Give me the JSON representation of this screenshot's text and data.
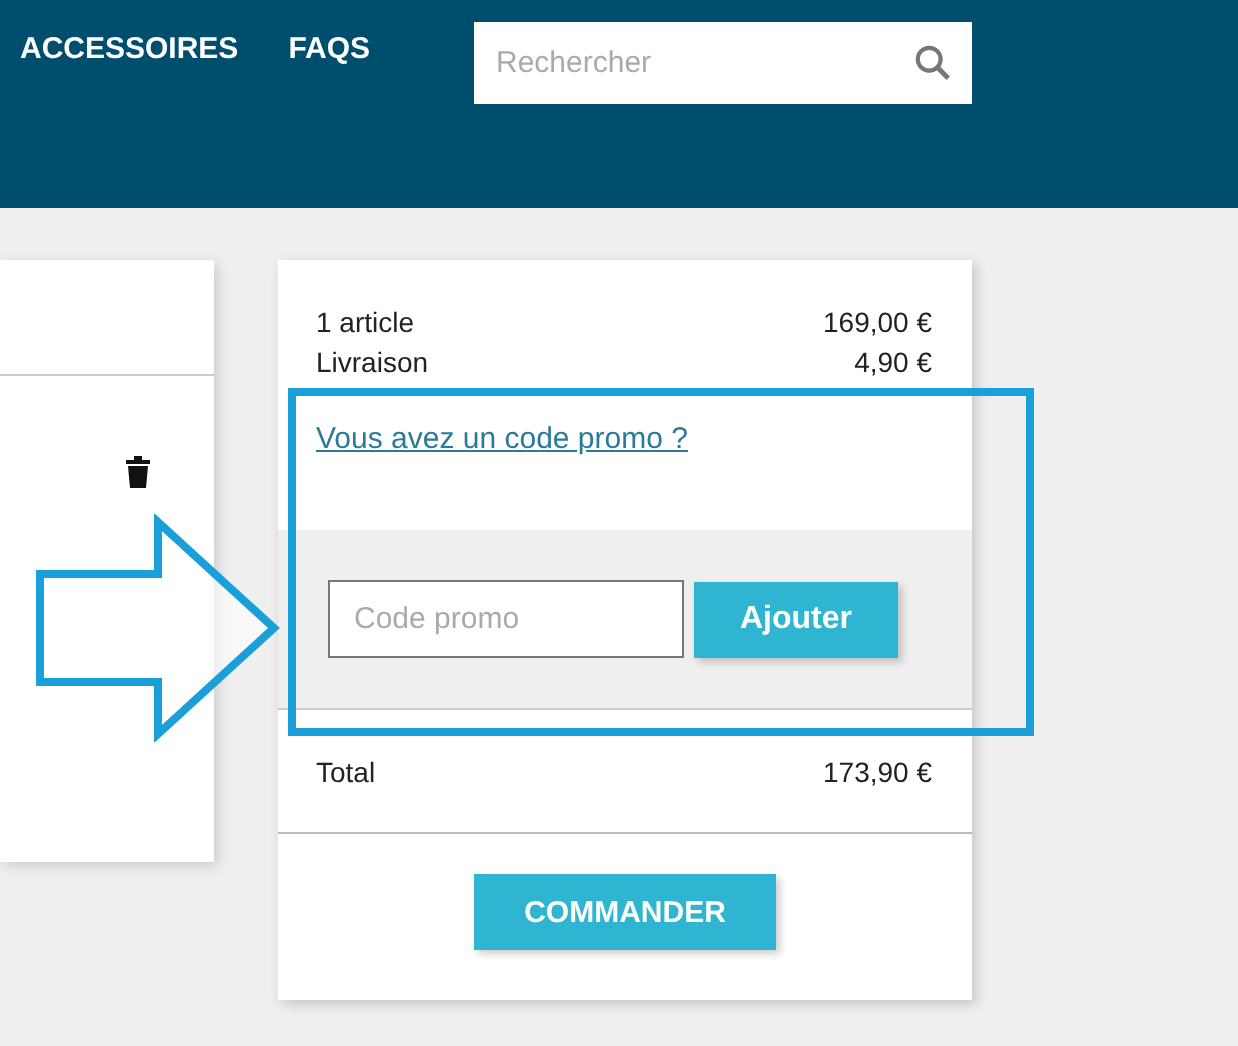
{
  "nav": {
    "items": [
      "ACCESSOIRES",
      "FAQS"
    ]
  },
  "search": {
    "placeholder": "Rechercher"
  },
  "summary": {
    "lines": [
      {
        "label": "1 article",
        "value": "169,00 €"
      },
      {
        "label": "Livraison",
        "value": "4,90 €"
      }
    ],
    "promo_link": "Vous avez un code promo ?",
    "promo_field": {
      "placeholder": "Code promo"
    },
    "promo_button": "Ajouter",
    "total": {
      "label": "Total",
      "value": "173,90 €"
    },
    "order_button": "COMMANDER"
  },
  "annotation": {
    "kind": "arrow-and-frame"
  }
}
